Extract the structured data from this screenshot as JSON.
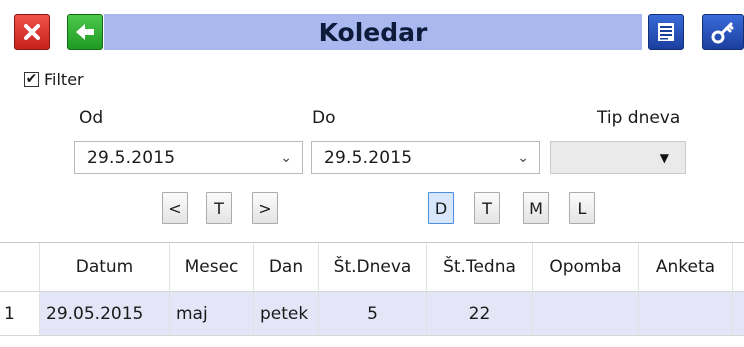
{
  "window": {
    "title": "Koledar"
  },
  "toolbar": {
    "close_icon": "close-icon",
    "back_icon": "back-arrow-icon",
    "print_icon": "print-icon",
    "key_icon": "key-icon",
    "colors": {
      "title_band": "#a9b8ee",
      "close": "#d6302a",
      "back": "#2fae32",
      "blue": "#2a55c0"
    }
  },
  "filter": {
    "checked": true,
    "label": "Filter"
  },
  "range": {
    "from_label": "Od",
    "from_value": "29.5.2015",
    "to_label": "Do",
    "to_value": "29.5.2015",
    "type_label": "Tip dneva",
    "type_value": ""
  },
  "nav_buttons": {
    "prev": "<",
    "today": "T",
    "next": ">"
  },
  "view_buttons": {
    "day": "D",
    "week": "T",
    "month": "M",
    "year": "L",
    "active": "D"
  },
  "table": {
    "columns": [
      "Datum",
      "Mesec",
      "Dan",
      "Št.Dneva",
      "Št.Tedna",
      "Opomba",
      "Anketa"
    ],
    "rows": [
      {
        "index": "1",
        "datum": "29.05.2015",
        "mesec": "maj",
        "dan": "petek",
        "st_dneva": "5",
        "st_tedna": "22",
        "opomba": "",
        "anketa": ""
      }
    ]
  }
}
